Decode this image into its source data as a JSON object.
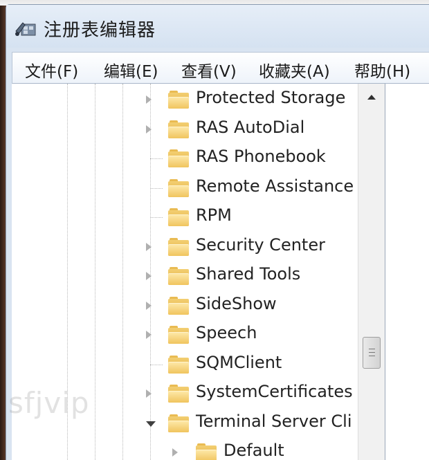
{
  "window": {
    "title": "注册表编辑器"
  },
  "menubar": [
    {
      "label": "文件(F)"
    },
    {
      "label": "编辑(E)"
    },
    {
      "label": "查看(V)"
    },
    {
      "label": "收藏夹(A)"
    },
    {
      "label": "帮助(H)"
    }
  ],
  "tree": {
    "items": [
      {
        "label": "Protected Storage",
        "expander": "collapsed"
      },
      {
        "label": "RAS AutoDial",
        "expander": "collapsed"
      },
      {
        "label": "RAS Phonebook",
        "expander": "none"
      },
      {
        "label": "Remote Assistance",
        "expander": "none"
      },
      {
        "label": "RPM",
        "expander": "none"
      },
      {
        "label": "Security Center",
        "expander": "collapsed"
      },
      {
        "label": "Shared Tools",
        "expander": "collapsed"
      },
      {
        "label": "SideShow",
        "expander": "collapsed"
      },
      {
        "label": "Speech",
        "expander": "collapsed"
      },
      {
        "label": "SQMClient",
        "expander": "none"
      },
      {
        "label": "SystemCertificates",
        "expander": "collapsed"
      },
      {
        "label": "Terminal Server Cli",
        "expander": "expanded"
      },
      {
        "label": "Default",
        "expander": "collapsed"
      }
    ]
  },
  "watermark": "sfjvip",
  "icons": {
    "app": "registry-editor-icon",
    "folder": "folder-icon",
    "expand": "triangle-right-icon",
    "collapse": "triangle-down-icon",
    "scroll_up": "scroll-up-arrow-icon"
  },
  "colors": {
    "folder": "#f0c45e",
    "titlebar": "#dce7f4",
    "accent_strip": "#d8743a"
  }
}
